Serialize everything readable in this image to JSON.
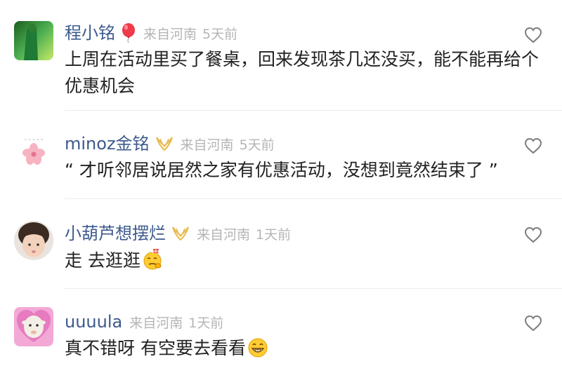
{
  "comments": [
    {
      "username": "程小铭",
      "badge": "balloon-icon",
      "location": "来自河南",
      "time": "5天前",
      "text": "上周在活动里买了餐桌，回来发现茶几还没买，能不能再给个优惠机会"
    },
    {
      "username": "minoz金铭",
      "badge": "gold-v-icon",
      "location": "来自河南",
      "time": "5天前",
      "text": "“ 才听邻居说居然之家有优惠活动，没想到竟然结束了 ”"
    },
    {
      "username": "小葫芦想摆烂",
      "badge": "gold-v-icon",
      "location": "来自河南",
      "time": "1天前",
      "text": "走 去逛逛",
      "emoji": "thinking-666-emoji"
    },
    {
      "username": "uuuula",
      "location": "来自河南",
      "time": "1天前",
      "text": "真不错呀 有空要去看看",
      "emoji": "grinning-emoji"
    }
  ],
  "colors": {
    "username": "#3d5a8e",
    "meta": "#b5b5b5",
    "text": "#222222",
    "badge_gold": "#e8b84a",
    "divider": "#ececec"
  }
}
